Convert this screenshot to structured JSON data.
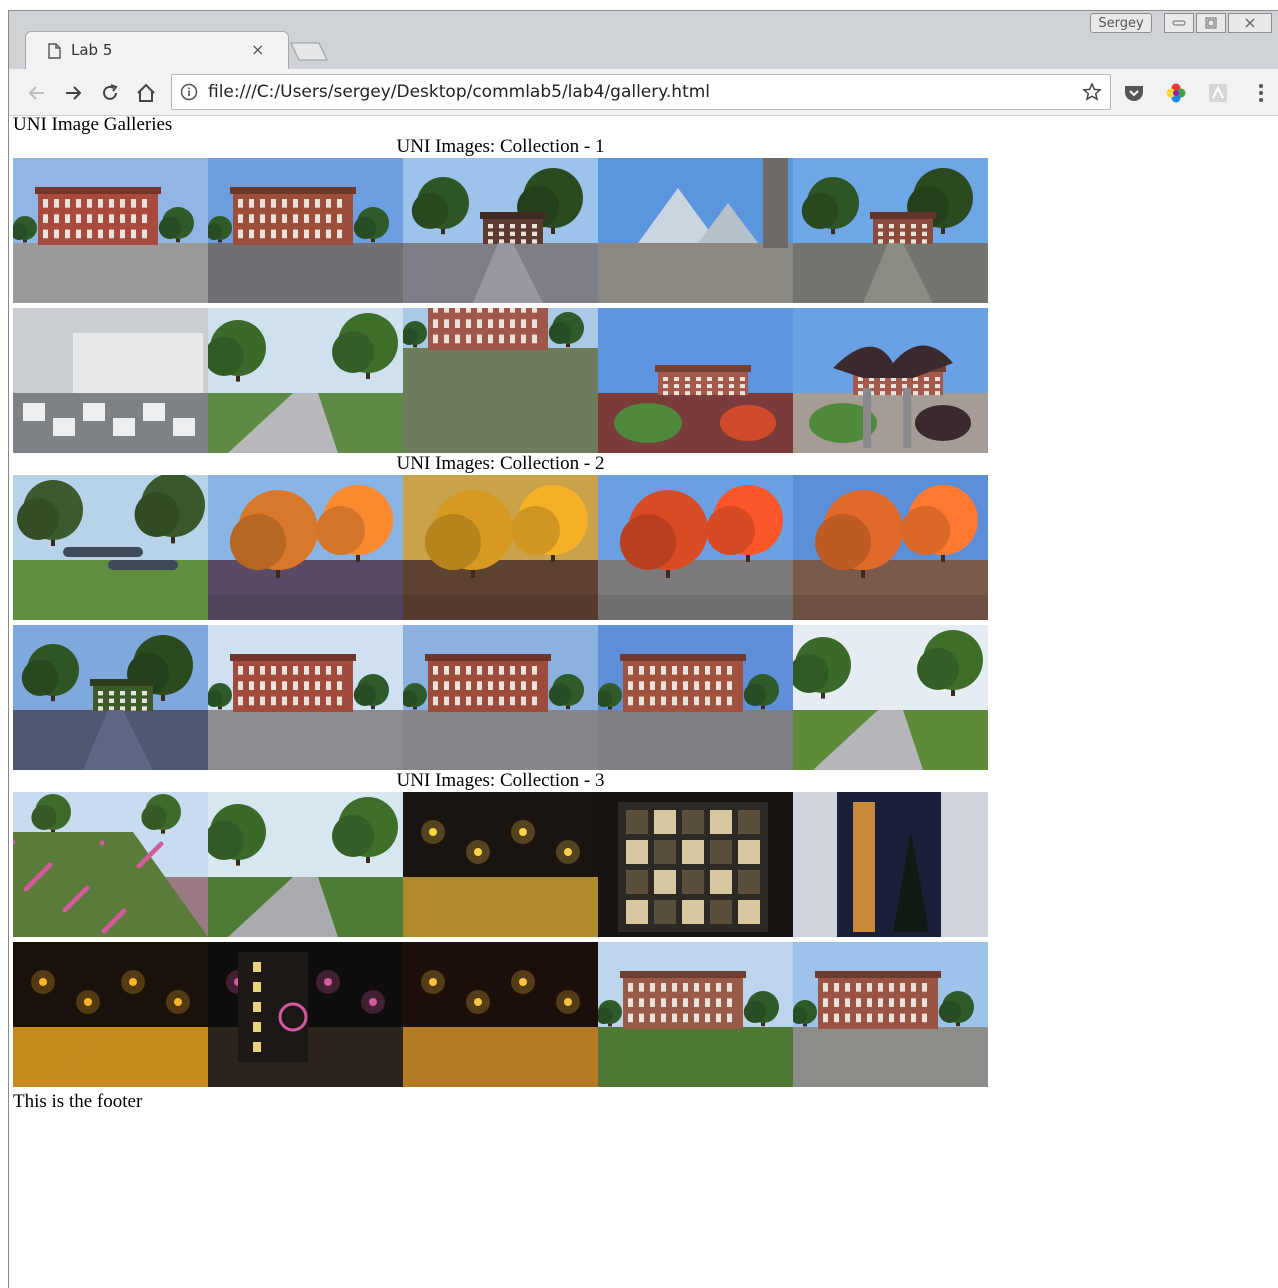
{
  "browser": {
    "tab_title": "Lab 5",
    "tab_close": "×",
    "profile_name": "Sergey",
    "url": "file:///C:/Users/sergey/Desktop/commlab5/lab4/gallery.html"
  },
  "page": {
    "heading": "UNI Image Galleries",
    "collections": [
      {
        "title": "UNI Images: Collection - 1",
        "photos": [
          {
            "scene": "brick-building",
            "sky": "#8fb6e4",
            "ground": "#9a9a9a",
            "accent": "#a84a3e"
          },
          {
            "scene": "brick-building",
            "sky": "#6d9fe0",
            "ground": "#6f6f74",
            "accent": "#9c4e3b"
          },
          {
            "scene": "trees-shade",
            "sky": "#9cc3ea",
            "ground": "#7e7e86",
            "accent": "#5c3a30"
          },
          {
            "scene": "glass-pyramid",
            "sky": "#5b95de",
            "ground": "#8d8782",
            "accent": "#c9d6e0"
          },
          {
            "scene": "trees-path",
            "sky": "#6ea6e6",
            "ground": "#74746e",
            "accent": "#8a4b3a"
          },
          {
            "scene": "computer-lab",
            "sky": "#c8ccd2",
            "ground": "#7d7f84",
            "accent": "#e4e6e8"
          },
          {
            "scene": "sidewalk-park",
            "sky": "#cfe1ee",
            "ground": "#5f8a45",
            "accent": "#b8b8bc"
          },
          {
            "scene": "campus-aerial",
            "sky": "#a9cae6",
            "ground": "#6d7d5c",
            "accent": "#a0574a"
          },
          {
            "scene": "autumn-shrubs",
            "sky": "#5f95e0",
            "ground": "#7b3b3a",
            "accent": "#d14a2a"
          },
          {
            "scene": "sculpture",
            "sky": "#6aa0e4",
            "ground": "#a49c95",
            "accent": "#3a2a2e"
          }
        ]
      },
      {
        "title": "UNI Images: Collection - 2",
        "photos": [
          {
            "scene": "cannons-lawn",
            "sky": "#b8d2ea",
            "ground": "#5f8f3e",
            "accent": "#3e4a5a"
          },
          {
            "scene": "autumn-tree",
            "sky": "#8ab4e4",
            "ground": "#5a4a66",
            "accent": "#d9782a"
          },
          {
            "scene": "autumn-tree",
            "sky": "#c9a24a",
            "ground": "#5d4232",
            "accent": "#d69a22"
          },
          {
            "scene": "autumn-tree",
            "sky": "#6b9fe2",
            "ground": "#7a7a7c",
            "accent": "#d94b24"
          },
          {
            "scene": "autumn-tree",
            "sky": "#5d8fd8",
            "ground": "#7a5a4a",
            "accent": "#e06a2a"
          },
          {
            "scene": "shaded-path",
            "sky": "#7fa9dc",
            "ground": "#4f5670",
            "accent": "#3e5a2a"
          },
          {
            "scene": "brick-building",
            "sky": "#cfe0f2",
            "ground": "#8c8c90",
            "accent": "#a24a3c"
          },
          {
            "scene": "brick-building",
            "sky": "#8ab1e0",
            "ground": "#85858a",
            "accent": "#9d4b3a"
          },
          {
            "scene": "brick-building",
            "sky": "#5e8fd8",
            "ground": "#808084",
            "accent": "#a0523e"
          },
          {
            "scene": "sidewalk-park",
            "sky": "#e6edf2",
            "ground": "#5e8a3a",
            "accent": "#b5b6ba"
          }
        ]
      },
      {
        "title": "UNI Images: Collection - 3",
        "photos": [
          {
            "scene": "flower-bed",
            "sky": "#c7dcef",
            "ground": "#9c7a84",
            "accent": "#d45a9a"
          },
          {
            "scene": "sidewalk-park",
            "sky": "#d8e6ef",
            "ground": "#4f7c34",
            "accent": "#a9abb0"
          },
          {
            "scene": "night-path",
            "sky": "#1a1410",
            "ground": "#b08a2a",
            "accent": "#ffd24a"
          },
          {
            "scene": "night-glass",
            "sky": "#15120f",
            "ground": "#2a2624",
            "accent": "#d8c8a0"
          },
          {
            "scene": "night-tower",
            "sky": "#1b1f3a",
            "ground": "#2a2a30",
            "accent": "#c88a3a"
          },
          {
            "scene": "night-path",
            "sky": "#1a120a",
            "ground": "#c58a1e",
            "accent": "#ffb52a"
          },
          {
            "scene": "night-building",
            "sky": "#0f0d0c",
            "ground": "#2a241c",
            "accent": "#d45aa0"
          },
          {
            "scene": "night-path",
            "sky": "#1c0f0a",
            "ground": "#b47a24",
            "accent": "#ffc244"
          },
          {
            "scene": "brick-building",
            "sky": "#bcd4ec",
            "ground": "#4e7a36",
            "accent": "#9a5a48"
          },
          {
            "scene": "brick-building",
            "sky": "#9ec3ea",
            "ground": "#8c8c88",
            "accent": "#9b5444"
          }
        ]
      }
    ],
    "footer": "This is the footer"
  }
}
